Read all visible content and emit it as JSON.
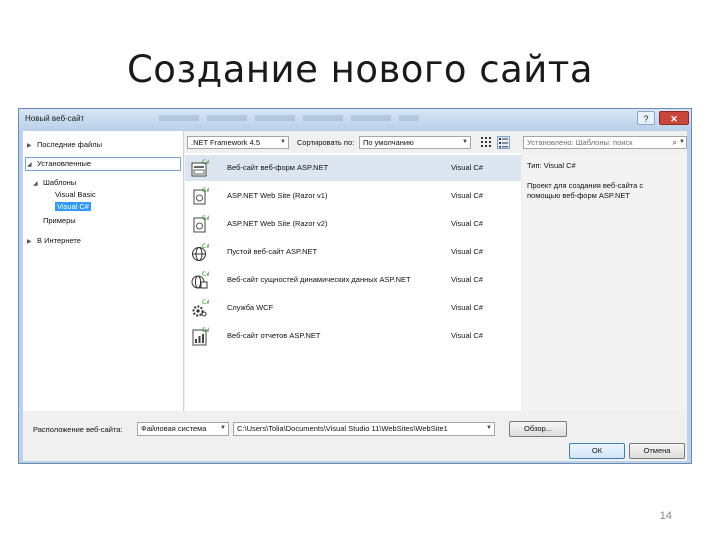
{
  "slide": {
    "title": "Создание нового сайта",
    "page_number": "14"
  },
  "dialog": {
    "title": "Новый веб-сайт",
    "help_label": "?",
    "close_label": "✕",
    "tree": {
      "recent": "Последние файлы",
      "installed": "Установленные",
      "templates": "Шаблоны",
      "vb": "Visual Basic",
      "cs": "Visual C#",
      "samples": "Примеры",
      "online": "В Интернете"
    },
    "toolbar": {
      "framework": ".NET Framework 4.5",
      "sort_label": "Сортировать по:",
      "sort_value": "По умолчанию"
    },
    "search": {
      "placeholder": "Установлено: Шаблоны: поиск"
    },
    "templates": [
      {
        "name": "Веб-сайт веб-форм ASP.NET",
        "lang": "Visual C#",
        "icon": "web-forms-icon"
      },
      {
        "name": "ASP.NET Web Site (Razor v1)",
        "lang": "Visual C#",
        "icon": "razor-v1-icon"
      },
      {
        "name": "ASP.NET Web Site (Razor v2)",
        "lang": "Visual C#",
        "icon": "razor-v2-icon"
      },
      {
        "name": "Пустой веб-сайт ASP.NET",
        "lang": "Visual C#",
        "icon": "globe-icon"
      },
      {
        "name": "Веб-сайт сущностей динамических данных ASP.NET",
        "lang": "Visual C#",
        "icon": "dynamic-data-icon"
      },
      {
        "name": "Служба WCF",
        "lang": "Visual C#",
        "icon": "wcf-gear-icon"
      },
      {
        "name": "Веб-сайт отчетов ASP.NET",
        "lang": "Visual C#",
        "icon": "report-icon"
      }
    ],
    "details": {
      "type_label": "Тип:",
      "type_value": "Visual C#",
      "description": "Проект для создания веб-сайта с помощью веб-форм ASP.NET"
    },
    "bottom": {
      "location_label": "Расположение веб-сайта:",
      "location_value": "Файловая система",
      "path": "C:\\Users\\Tolia\\Documents\\Visual Studio 11\\WebSites\\WebSite1",
      "browse": "Обзор...",
      "ok": "ОК",
      "cancel": "Отмена"
    },
    "colors": {
      "accent": "#3399ff",
      "frame": "#bcd2ea",
      "selected_row": "#dde6f0",
      "close": "#c9463d"
    }
  }
}
